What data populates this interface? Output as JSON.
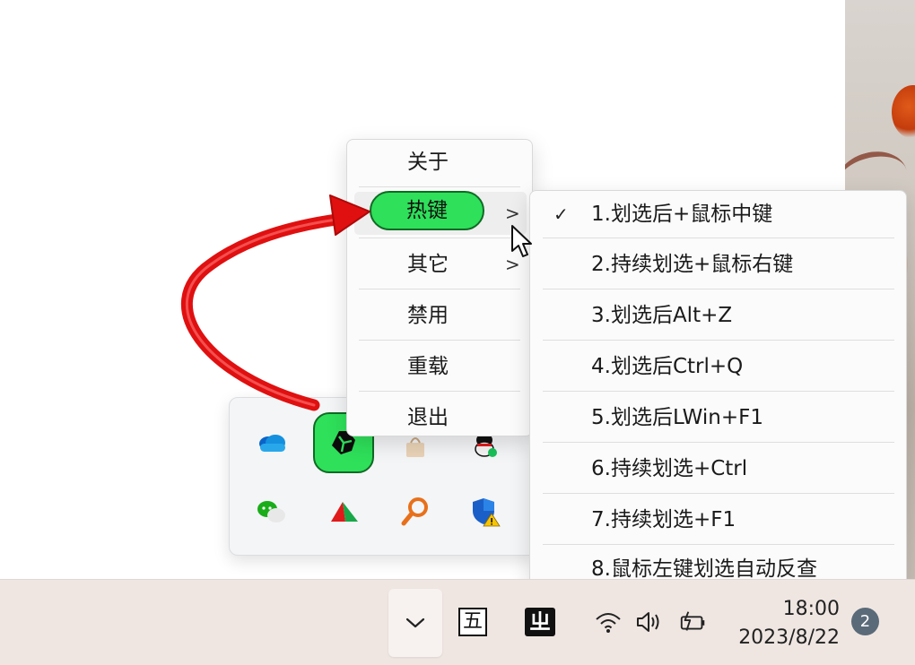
{
  "context_menu": {
    "items": [
      {
        "label": "关于",
        "has_submenu": false
      },
      {
        "label": "热键",
        "has_submenu": true,
        "active": true
      },
      {
        "label": "其它",
        "has_submenu": true
      },
      {
        "label": "禁用",
        "has_submenu": false
      },
      {
        "label": "重载",
        "has_submenu": false
      },
      {
        "label": "退出",
        "has_submenu": false
      }
    ],
    "chevron_glyph": ">"
  },
  "hotkey_submenu": {
    "check_glyph": "✓",
    "items": [
      {
        "label": "1.划选后+鼠标中键",
        "checked": true
      },
      {
        "label": "2.持续划选+鼠标右键",
        "checked": false
      },
      {
        "label": "3.划选后Alt+Z",
        "checked": false
      },
      {
        "label": "4.划选后Ctrl+Q",
        "checked": false
      },
      {
        "label": "5.划选后LWin+F1",
        "checked": false
      },
      {
        "label": "6.持续划选+Ctrl",
        "checked": false
      },
      {
        "label": "7.持续划选+F1",
        "checked": false
      },
      {
        "label": "8.鼠标左键划选自动反查",
        "checked": false
      }
    ]
  },
  "tray_flyout": {
    "icons": [
      "onedrive-icon",
      "app-highlight-icon",
      "bag-app-icon",
      "qq-icon",
      "wechat-icon",
      "vector-app-icon",
      "search-key-icon",
      "security-shield-icon"
    ]
  },
  "taskbar": {
    "ime_label": "五",
    "ime2_label": "ㄓ",
    "time": "18:00",
    "date": "2023/8/22",
    "notification_count": "2",
    "icons": [
      "chevron-up-icon",
      "wifi-icon",
      "volume-icon",
      "battery-icon"
    ]
  },
  "colors": {
    "highlight_green": "#2ee05a",
    "highlight_border": "#0f6b24",
    "annotation_arrow": "#e01010",
    "taskbar_bg": "#efe6e2",
    "badge": "#5a6a78"
  }
}
